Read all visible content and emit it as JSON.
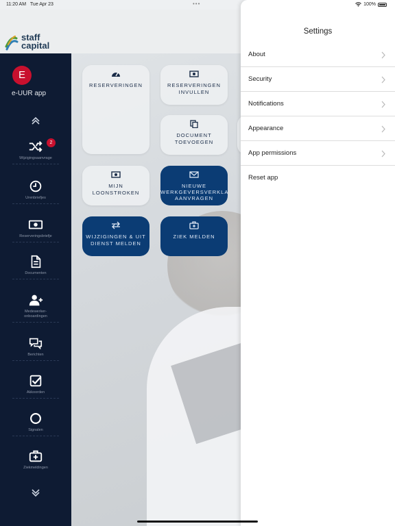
{
  "status_bar": {
    "time": "11:20 AM",
    "date": "Tue Apr 23",
    "battery": "100%"
  },
  "logo": {
    "line1": "staff",
    "line2": "capital"
  },
  "sidebar": {
    "avatar_initial": "E",
    "app_name": "e-UUR app",
    "items": [
      {
        "label": "Wijzigingsaanvrage",
        "icon": "shuffle-icon",
        "badge": "2"
      },
      {
        "label": "Urenbriefjes",
        "icon": "clock-icon"
      },
      {
        "label": "Reserveringsbriefje",
        "icon": "banknote-icon"
      },
      {
        "label": "Documenten",
        "icon": "document-icon"
      },
      {
        "label": "Medewerker-\nonboardingen",
        "icon": "user-plus-icon"
      },
      {
        "label": "Berichten",
        "icon": "chat-icon"
      },
      {
        "label": "Akkoorden",
        "icon": "checkbox-icon"
      },
      {
        "label": "Signalen",
        "icon": "circle-icon"
      },
      {
        "label": "Ziekmeldingen",
        "icon": "medkit-icon"
      }
    ]
  },
  "tiles": [
    {
      "label": "RESERVERINGEN",
      "icon": "gauge-icon",
      "style": "light"
    },
    {
      "label": "RESERVERINGEN\nINVULLEN",
      "icon": "banknote-icon",
      "style": "light"
    },
    {
      "label": "DOCUMENT\nTOEVOEGEN",
      "icon": "copy-icon",
      "style": "light"
    },
    {
      "label": "MIJN\nLOONSTROKEN",
      "icon": "banknote-icon",
      "style": "light"
    },
    {
      "label": "NIEUWE\nWERKGEVERSVERKLA\nAANVRAGEN",
      "icon": "mail-icon",
      "style": "dark"
    },
    {
      "label": "WIJZIGINGEN & UIT\nDIENST MELDEN",
      "icon": "arrows-icon",
      "style": "dark"
    },
    {
      "label": "ZIEK MELDEN",
      "icon": "medkit-icon",
      "style": "dark"
    }
  ],
  "settings": {
    "title": "Settings",
    "items": [
      {
        "label": "About",
        "chevron": true
      },
      {
        "label": "Security",
        "chevron": true
      },
      {
        "label": "Notifications",
        "chevron": true
      },
      {
        "label": "Appearance",
        "chevron": true
      },
      {
        "label": "App permissions",
        "chevron": true
      },
      {
        "label": "Reset app",
        "chevron": false
      }
    ]
  },
  "colors": {
    "sidebar": "#0e1b33",
    "accent_red": "#c8102e",
    "tile_dark": "#0b3c74",
    "tile_text": "#1a2c48"
  }
}
